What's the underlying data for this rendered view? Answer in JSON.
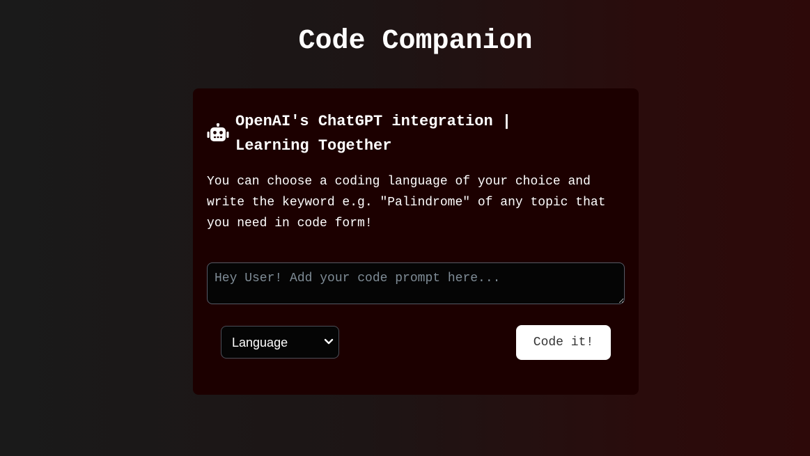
{
  "page": {
    "title": "Code Companion"
  },
  "card": {
    "icon": "robot-icon",
    "title_line1": "OpenAI's ChatGPT integration |",
    "title_line2": "Learning Together",
    "description": "You can choose a coding language of your choice and write the keyword e.g. \"Palindrome\" of any topic that you need in code form!",
    "prompt": {
      "value": "",
      "placeholder": "Hey User! Add your code prompt here..."
    },
    "language_select": {
      "selected": "Language",
      "icon": "chevron-down-icon"
    },
    "submit_label": "Code it!"
  },
  "colors": {
    "card_background": "#1c0000",
    "button_background": "#ffffff",
    "input_background": "#050505",
    "placeholder": "#7f8c96"
  }
}
